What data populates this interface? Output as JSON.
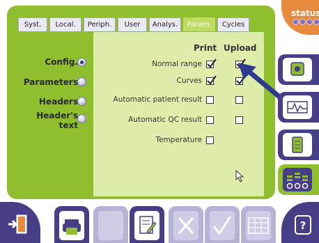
{
  "tabs": [
    {
      "label": "Syst."
    },
    {
      "label": "Local."
    },
    {
      "label": "Periph."
    },
    {
      "label": "User"
    },
    {
      "label": "Analys."
    },
    {
      "label": "Param."
    },
    {
      "label": "Cycles"
    }
  ],
  "active_tab_index": 5,
  "left_menu": [
    {
      "label": "Config.",
      "selected": true
    },
    {
      "label": "Parameters",
      "selected": false
    },
    {
      "label": "Headers",
      "selected": false
    },
    {
      "label": "Header's text",
      "selected": false
    }
  ],
  "columns": {
    "print": "Print",
    "upload": "Upload"
  },
  "rows": [
    {
      "label": "Normal range",
      "print": true,
      "upload": true
    },
    {
      "label": "Curves",
      "print": true,
      "upload": true
    },
    {
      "label": "Automatic patient result",
      "print": false,
      "upload": false
    },
    {
      "label": "Automatic QC result",
      "print": false,
      "upload": false
    },
    {
      "label": "Temperature",
      "print": false,
      "upload": null
    }
  ],
  "status": {
    "label": "status"
  },
  "right_buttons": [
    {
      "icon": "camera-patient-icon"
    },
    {
      "icon": "waveform-curve-icon"
    },
    {
      "icon": "book-list-icon"
    },
    {
      "icon": "bar-chart-settings-icon",
      "active": true
    }
  ],
  "bottom_buttons": [
    {
      "icon": "exit-door-icon"
    },
    {
      "icon": "printer-icon"
    },
    {
      "icon": "blank-icon",
      "disabled": true
    },
    {
      "icon": "edit-document-icon"
    },
    {
      "icon": "cancel-x-icon",
      "disabled": true
    },
    {
      "icon": "validate-check-icon",
      "disabled": true
    },
    {
      "icon": "keyboard-icon",
      "disabled": true
    },
    {
      "icon": "help-icon"
    }
  ],
  "colors": {
    "frame_green": "#8fbf2e",
    "content_green": "#deedaa",
    "nav_purple": "#463e86",
    "status_orange": "#e88a3e",
    "arrow_blue": "#2c3a8f"
  }
}
